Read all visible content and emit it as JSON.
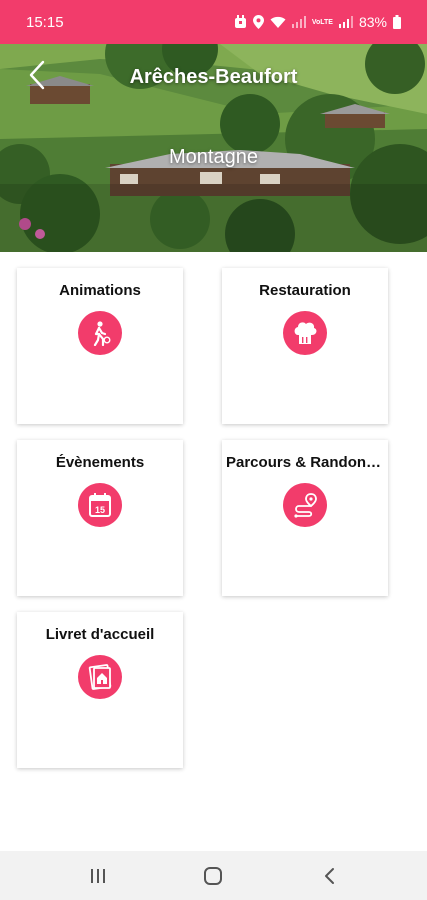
{
  "status_bar": {
    "time": "15:15",
    "battery_text": "83%",
    "network_label": "VoLTE",
    "icons": [
      "alarm-icon",
      "location-icon",
      "wifi-icon",
      "signal-icon",
      "battery-icon"
    ]
  },
  "header": {
    "title": "Arêches-Beaufort",
    "subtitle": "Montagne",
    "back_icon": "chevron-left-icon"
  },
  "cards": [
    {
      "title": "Animations",
      "icon": "walking-person-icon"
    },
    {
      "title": "Restauration",
      "icon": "chef-hat-icon"
    },
    {
      "title": "Évènements",
      "icon": "calendar-icon",
      "icon_text": "15"
    },
    {
      "title": "Parcours & Randonnées",
      "icon": "route-icon"
    },
    {
      "title": "Livret d'accueil",
      "icon": "welcome-booklet-icon"
    }
  ],
  "nav_bar": {
    "buttons": [
      "recent-apps-icon",
      "home-icon",
      "back-icon"
    ]
  },
  "colors": {
    "accent": "#f23c6b",
    "nav_bar": "#f2f2f2",
    "card_bg": "#ffffff"
  }
}
